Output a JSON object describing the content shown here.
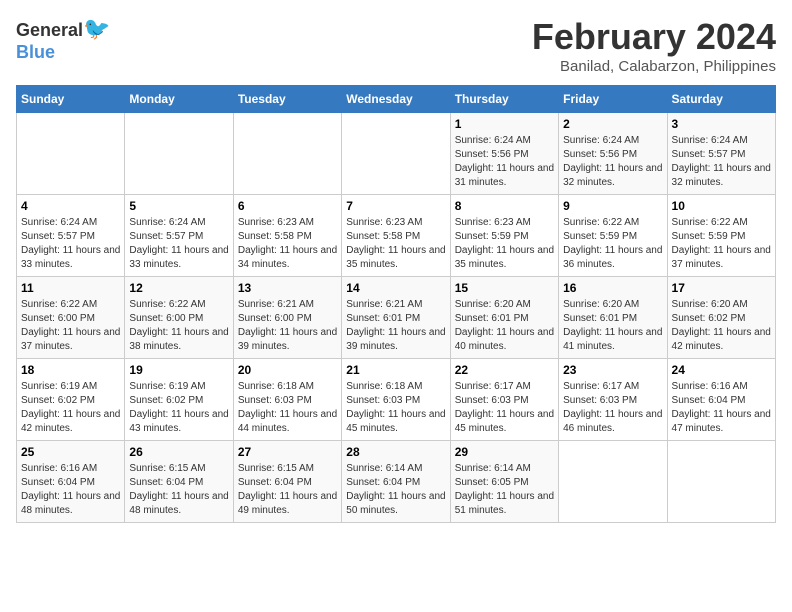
{
  "header": {
    "logo": {
      "general": "General",
      "blue": "Blue"
    },
    "title": "February 2024",
    "location": "Banilad, Calabarzon, Philippines"
  },
  "calendar": {
    "days_of_week": [
      "Sunday",
      "Monday",
      "Tuesday",
      "Wednesday",
      "Thursday",
      "Friday",
      "Saturday"
    ],
    "weeks": [
      [
        {
          "day": "",
          "info": ""
        },
        {
          "day": "",
          "info": ""
        },
        {
          "day": "",
          "info": ""
        },
        {
          "day": "",
          "info": ""
        },
        {
          "day": "1",
          "info": "Sunrise: 6:24 AM\nSunset: 5:56 PM\nDaylight: 11 hours and 31 minutes."
        },
        {
          "day": "2",
          "info": "Sunrise: 6:24 AM\nSunset: 5:56 PM\nDaylight: 11 hours and 32 minutes."
        },
        {
          "day": "3",
          "info": "Sunrise: 6:24 AM\nSunset: 5:57 PM\nDaylight: 11 hours and 32 minutes."
        }
      ],
      [
        {
          "day": "4",
          "info": "Sunrise: 6:24 AM\nSunset: 5:57 PM\nDaylight: 11 hours and 33 minutes."
        },
        {
          "day": "5",
          "info": "Sunrise: 6:24 AM\nSunset: 5:57 PM\nDaylight: 11 hours and 33 minutes."
        },
        {
          "day": "6",
          "info": "Sunrise: 6:23 AM\nSunset: 5:58 PM\nDaylight: 11 hours and 34 minutes."
        },
        {
          "day": "7",
          "info": "Sunrise: 6:23 AM\nSunset: 5:58 PM\nDaylight: 11 hours and 35 minutes."
        },
        {
          "day": "8",
          "info": "Sunrise: 6:23 AM\nSunset: 5:59 PM\nDaylight: 11 hours and 35 minutes."
        },
        {
          "day": "9",
          "info": "Sunrise: 6:22 AM\nSunset: 5:59 PM\nDaylight: 11 hours and 36 minutes."
        },
        {
          "day": "10",
          "info": "Sunrise: 6:22 AM\nSunset: 5:59 PM\nDaylight: 11 hours and 37 minutes."
        }
      ],
      [
        {
          "day": "11",
          "info": "Sunrise: 6:22 AM\nSunset: 6:00 PM\nDaylight: 11 hours and 37 minutes."
        },
        {
          "day": "12",
          "info": "Sunrise: 6:22 AM\nSunset: 6:00 PM\nDaylight: 11 hours and 38 minutes."
        },
        {
          "day": "13",
          "info": "Sunrise: 6:21 AM\nSunset: 6:00 PM\nDaylight: 11 hours and 39 minutes."
        },
        {
          "day": "14",
          "info": "Sunrise: 6:21 AM\nSunset: 6:01 PM\nDaylight: 11 hours and 39 minutes."
        },
        {
          "day": "15",
          "info": "Sunrise: 6:20 AM\nSunset: 6:01 PM\nDaylight: 11 hours and 40 minutes."
        },
        {
          "day": "16",
          "info": "Sunrise: 6:20 AM\nSunset: 6:01 PM\nDaylight: 11 hours and 41 minutes."
        },
        {
          "day": "17",
          "info": "Sunrise: 6:20 AM\nSunset: 6:02 PM\nDaylight: 11 hours and 42 minutes."
        }
      ],
      [
        {
          "day": "18",
          "info": "Sunrise: 6:19 AM\nSunset: 6:02 PM\nDaylight: 11 hours and 42 minutes."
        },
        {
          "day": "19",
          "info": "Sunrise: 6:19 AM\nSunset: 6:02 PM\nDaylight: 11 hours and 43 minutes."
        },
        {
          "day": "20",
          "info": "Sunrise: 6:18 AM\nSunset: 6:03 PM\nDaylight: 11 hours and 44 minutes."
        },
        {
          "day": "21",
          "info": "Sunrise: 6:18 AM\nSunset: 6:03 PM\nDaylight: 11 hours and 45 minutes."
        },
        {
          "day": "22",
          "info": "Sunrise: 6:17 AM\nSunset: 6:03 PM\nDaylight: 11 hours and 45 minutes."
        },
        {
          "day": "23",
          "info": "Sunrise: 6:17 AM\nSunset: 6:03 PM\nDaylight: 11 hours and 46 minutes."
        },
        {
          "day": "24",
          "info": "Sunrise: 6:16 AM\nSunset: 6:04 PM\nDaylight: 11 hours and 47 minutes."
        }
      ],
      [
        {
          "day": "25",
          "info": "Sunrise: 6:16 AM\nSunset: 6:04 PM\nDaylight: 11 hours and 48 minutes."
        },
        {
          "day": "26",
          "info": "Sunrise: 6:15 AM\nSunset: 6:04 PM\nDaylight: 11 hours and 48 minutes."
        },
        {
          "day": "27",
          "info": "Sunrise: 6:15 AM\nSunset: 6:04 PM\nDaylight: 11 hours and 49 minutes."
        },
        {
          "day": "28",
          "info": "Sunrise: 6:14 AM\nSunset: 6:04 PM\nDaylight: 11 hours and 50 minutes."
        },
        {
          "day": "29",
          "info": "Sunrise: 6:14 AM\nSunset: 6:05 PM\nDaylight: 11 hours and 51 minutes."
        },
        {
          "day": "",
          "info": ""
        },
        {
          "day": "",
          "info": ""
        }
      ]
    ]
  }
}
